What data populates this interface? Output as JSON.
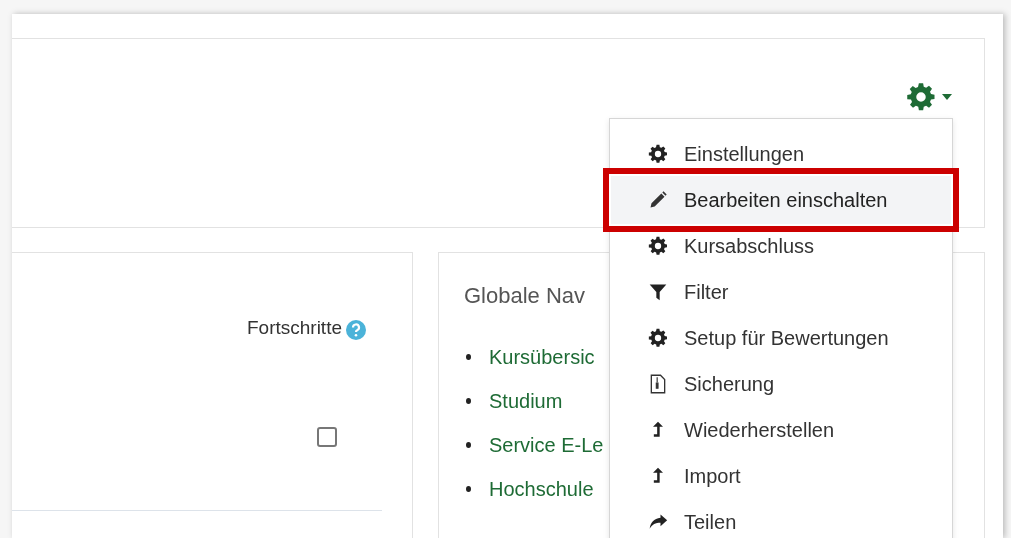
{
  "progress_block": {
    "label": "Fortschritte",
    "checkbox": {
      "checked": false
    }
  },
  "global_navigation": {
    "title": "Globale Nav",
    "links": [
      "Kursübersic",
      "Studium",
      "Service E-Le",
      "Hochschule"
    ]
  },
  "actions_menu": {
    "items": [
      {
        "kind": "gear",
        "label": "Einstellungen",
        "selected": false
      },
      {
        "kind": "pencil",
        "label": "Bearbeiten einschalten",
        "selected": true
      },
      {
        "kind": "gear",
        "label": "Kursabschluss",
        "selected": false
      },
      {
        "kind": "filter",
        "label": "Filter",
        "selected": false
      },
      {
        "kind": "gear",
        "label": "Setup für Bewertungen",
        "selected": false
      },
      {
        "kind": "archive",
        "label": "Sicherung",
        "selected": false
      },
      {
        "kind": "upload",
        "label": "Wiederherstellen",
        "selected": false
      },
      {
        "kind": "upload",
        "label": "Import",
        "selected": false
      },
      {
        "kind": "share",
        "label": "Teilen",
        "selected": false
      }
    ]
  }
}
